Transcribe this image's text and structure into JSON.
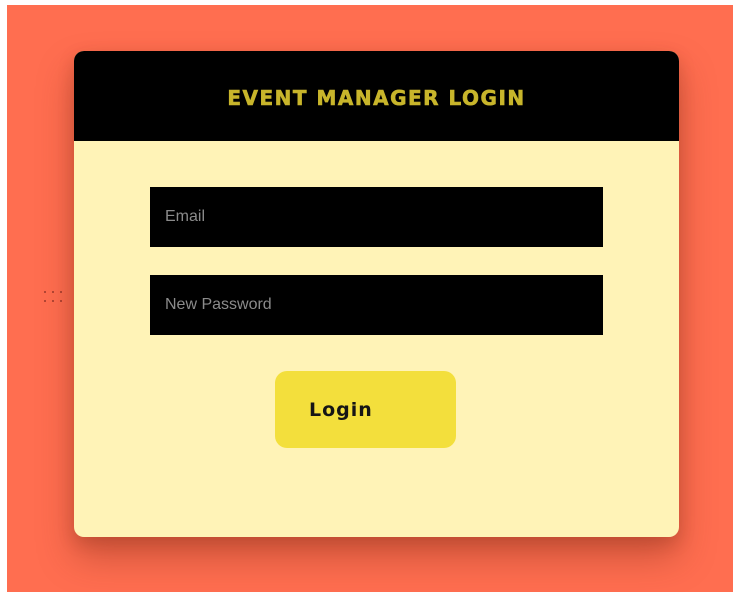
{
  "login_card": {
    "title": "EVENT MANAGER LOGIN",
    "email": {
      "placeholder": "Email",
      "value": ""
    },
    "password": {
      "placeholder": "New Password",
      "value": ""
    },
    "login_label": "Login"
  },
  "colors": {
    "page_background": "#ff6e50",
    "card_background": "#fff3b7",
    "header_background": "#000000",
    "title_text": "#c8b52b",
    "input_background": "#000000",
    "button_background": "#f3df3c"
  },
  "icons": {
    "drag_handle": "drag-handle-icon"
  }
}
